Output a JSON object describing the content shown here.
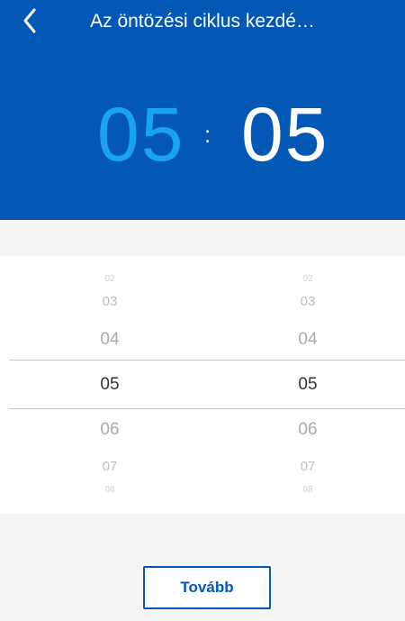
{
  "header": {
    "back_icon": "chevron-left-icon",
    "title": "Az öntözési ciklus kezdé…",
    "background_color": "#0357b5"
  },
  "time": {
    "hour": "05",
    "separator": ":",
    "minute": "05",
    "hour_color": "#1aa3f0",
    "minute_color": "#ffffff"
  },
  "picker": {
    "hours": [
      "02",
      "03",
      "04",
      "05",
      "06",
      "07",
      "08"
    ],
    "minutes": [
      "02",
      "03",
      "04",
      "05",
      "06",
      "07",
      "08"
    ],
    "selected_index": 3
  },
  "footer": {
    "next_label": "Tovább"
  }
}
